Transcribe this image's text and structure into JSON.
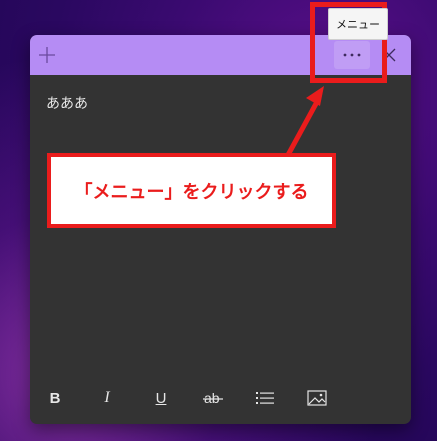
{
  "colors": {
    "titlebar": "#b58cf4",
    "note_body": "#333333",
    "annotation_red": "#ea1c1c"
  },
  "titlebar": {
    "icons": {
      "add": "plus-icon",
      "menu": "ellipsis-icon",
      "close": "close-icon"
    }
  },
  "note": {
    "text": "あああ"
  },
  "tooltip": {
    "text": "メニュー"
  },
  "annotation": {
    "callout_text": "「メニュー」をクリックする"
  },
  "toolbar": {
    "bold": "B",
    "italic": "I",
    "underline": "U",
    "icons": [
      "bold-icon",
      "italic-icon",
      "underline-icon",
      "strikethrough-icon",
      "bullet-list-icon",
      "insert-image-icon"
    ]
  }
}
